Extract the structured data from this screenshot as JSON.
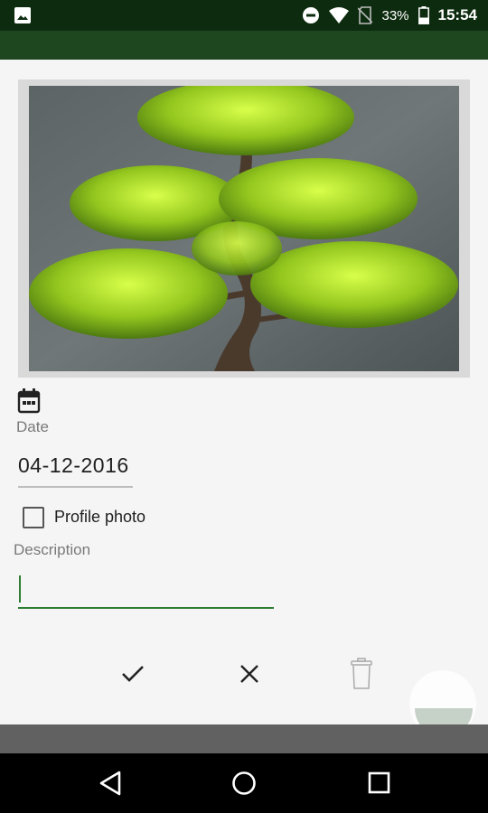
{
  "status_bar": {
    "battery_percent": "33%",
    "time": "15:54",
    "left_icon": "image-notification-icon",
    "right_icons": [
      "do-not-disturb-icon",
      "wifi-icon",
      "no-sim-icon",
      "battery-icon"
    ]
  },
  "form": {
    "date_label": "Date",
    "date_value": "04-12-2016",
    "profile_photo_label": "Profile photo",
    "profile_photo_checked": false,
    "description_label": "Description",
    "description_value": ""
  },
  "actions": [
    "check-icon",
    "close-icon",
    "trash-icon"
  ],
  "nav_bar": [
    "back-icon",
    "home-icon",
    "recents-icon"
  ],
  "colors": {
    "status_bar": "#0d2c0f",
    "app_bar": "#1e4720",
    "accent": "#2e7d32",
    "background": "#f5f5f5"
  }
}
